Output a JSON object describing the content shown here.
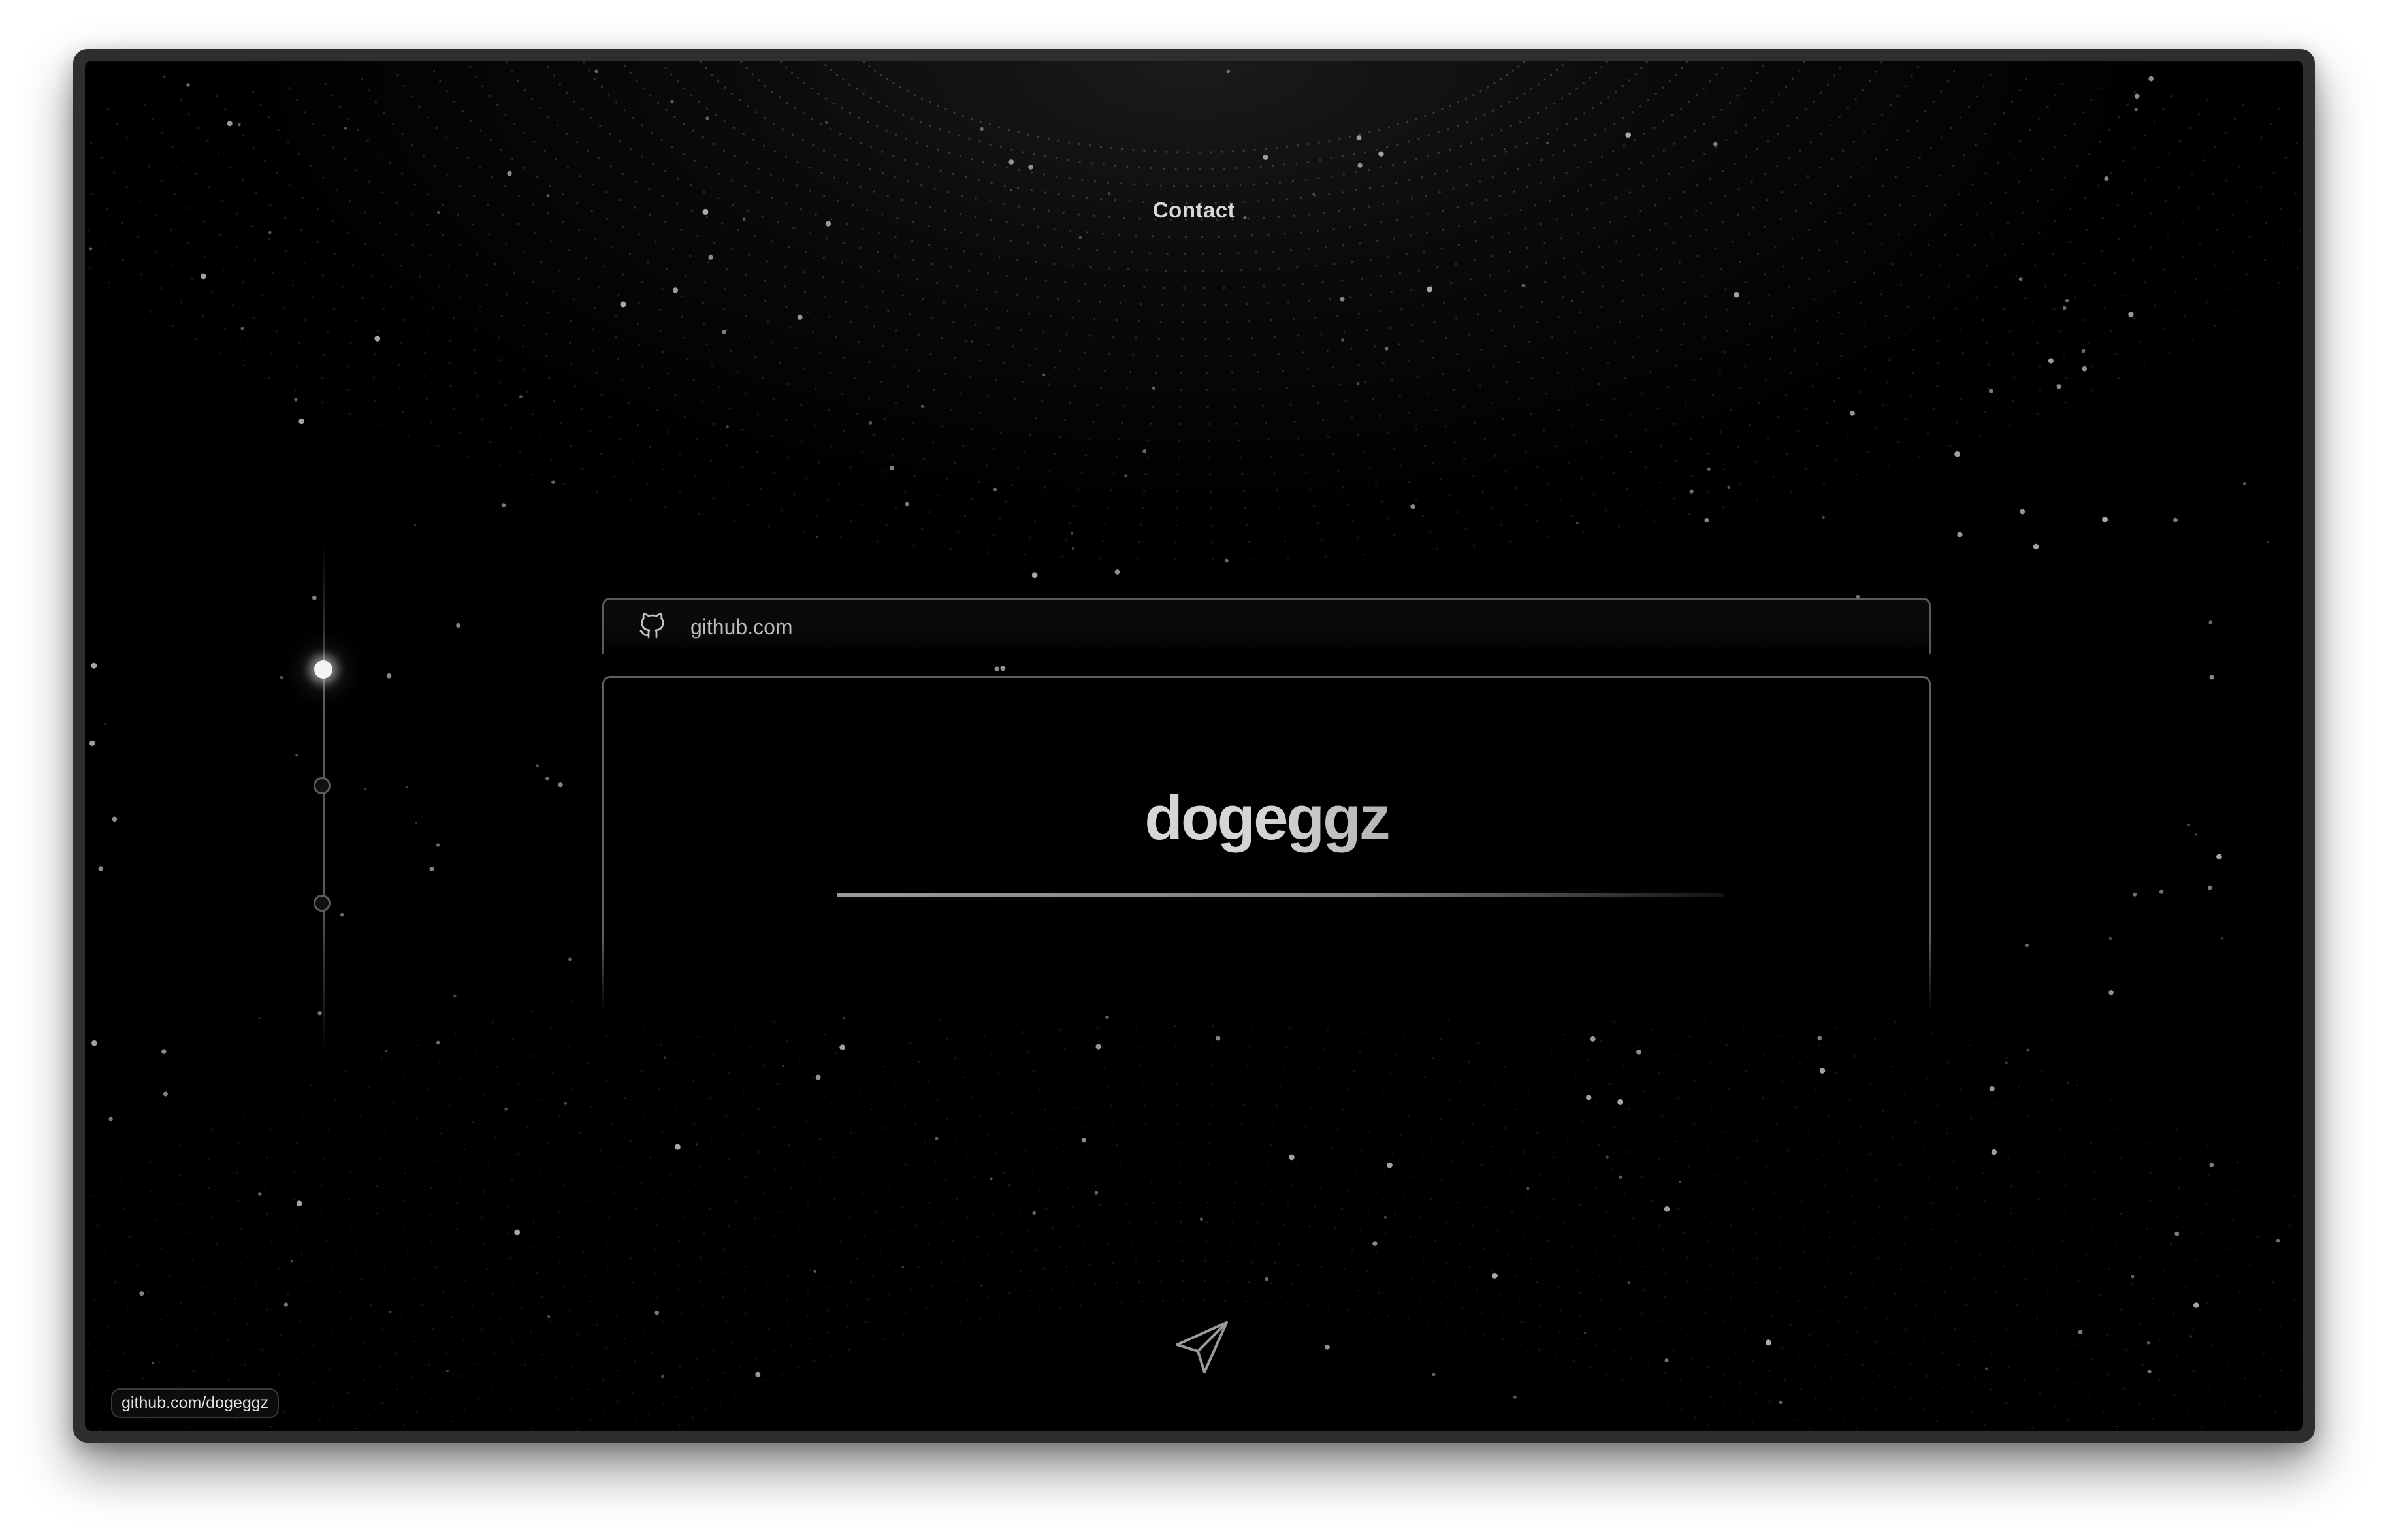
{
  "nav": {
    "title": "Contact"
  },
  "timeline": {
    "steps": 3,
    "active_index": 0
  },
  "card": {
    "site_icon": "github-icon",
    "site_label": "github.com",
    "username": "dogeggz"
  },
  "send": {
    "icon": "paper-plane-icon"
  },
  "status_bar": {
    "link_text": "github.com/dogeggz"
  },
  "colors": {
    "background": "#000000",
    "accent": "#ffffff",
    "border": "#5a5a5a"
  }
}
